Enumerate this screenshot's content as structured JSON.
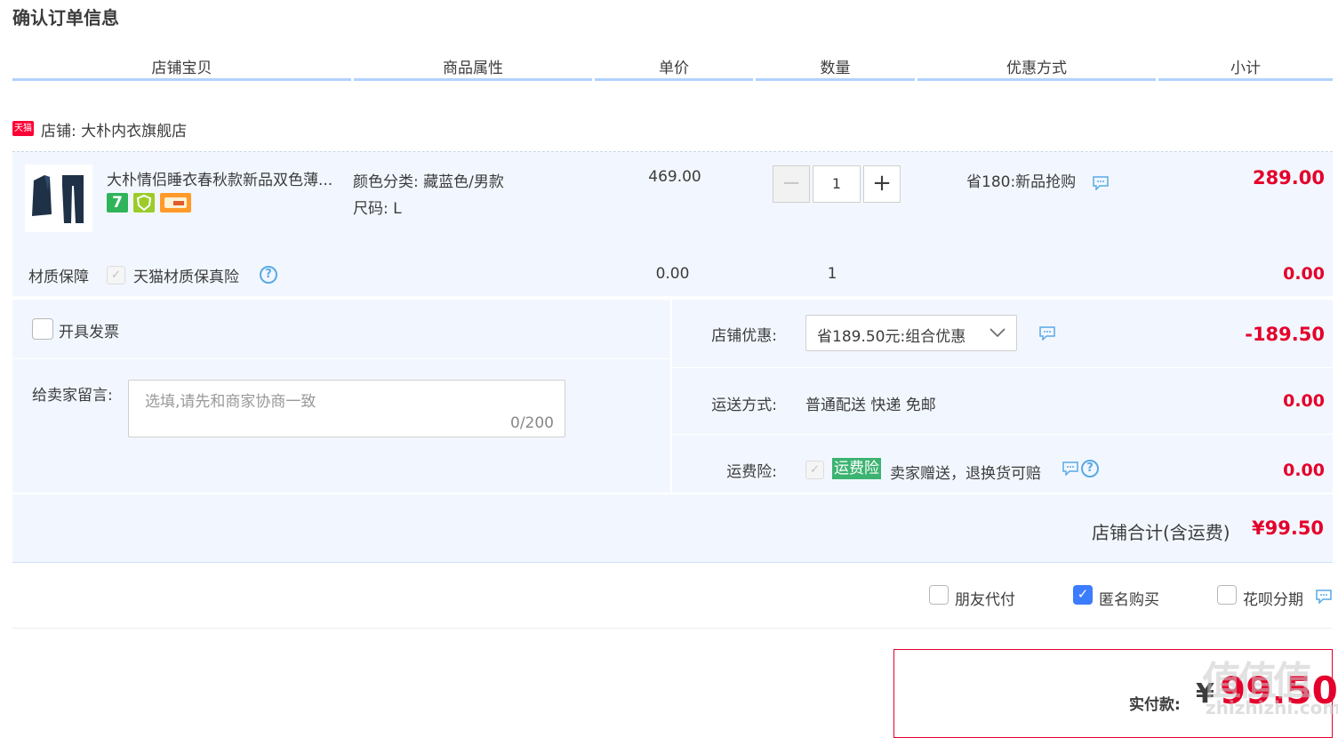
{
  "page": {
    "title": "确认订单信息"
  },
  "columns": [
    "店铺宝贝",
    "商品属性",
    "单价",
    "数量",
    "优惠方式",
    "小计"
  ],
  "store": {
    "badge": "天猫",
    "label": "店铺: 大朴内衣旗舰店"
  },
  "item": {
    "name": "大朴情侣睡衣春秋款新品双色薄...",
    "badge_7": "7",
    "attr_color": "颜色分类: 藏蓝色/男款",
    "attr_size": "尺码: L",
    "price": "469.00",
    "qty_minus": "−",
    "qty": "1",
    "qty_plus": "+",
    "promo": "省180:新品抢购",
    "subtotal": "289.00"
  },
  "insurance": {
    "label": "材质保障",
    "check": "✓",
    "name": "天猫材质保真险",
    "qmark": "?",
    "price": "0.00",
    "qty": "1",
    "subtotal": "0.00"
  },
  "invoice": {
    "label": "开具发票"
  },
  "message": {
    "label": "给卖家留言:",
    "placeholder": "选填,请先和商家协商一致",
    "counter": "0/200"
  },
  "store_discount": {
    "label": "店铺优惠:",
    "selected": "省189.50元:组合优惠",
    "amount": "-189.50"
  },
  "shipping": {
    "label": "运送方式:",
    "value": "普通配送 快递 免邮",
    "amount": "0.00"
  },
  "freight_insurance": {
    "label": "运费险:",
    "check": "✓",
    "tag": "运费险",
    "desc": "卖家赠送，退换货可赔",
    "qmark": "?",
    "amount": "0.00"
  },
  "store_total": {
    "label": "店铺合计(含运费)",
    "amount": "¥99.50"
  },
  "options": {
    "friend_pay": "朋友代付",
    "anonymous": "匿名购买",
    "anonymous_check": "✓",
    "huabei": "花呗分期"
  },
  "payment": {
    "label": "实付款:",
    "currency": "¥",
    "amount": "99.50"
  },
  "watermark": {
    "text": "值值值",
    "sub": "zhizhizhi.com"
  },
  "colors": {
    "accent_red": "#e4002b",
    "header_line": "#b2d1ff",
    "row_bg": "#f2f7ff",
    "tmall_red": "#ff0036",
    "freight_green": "#3cb371",
    "check_blue": "#3c7cff"
  }
}
